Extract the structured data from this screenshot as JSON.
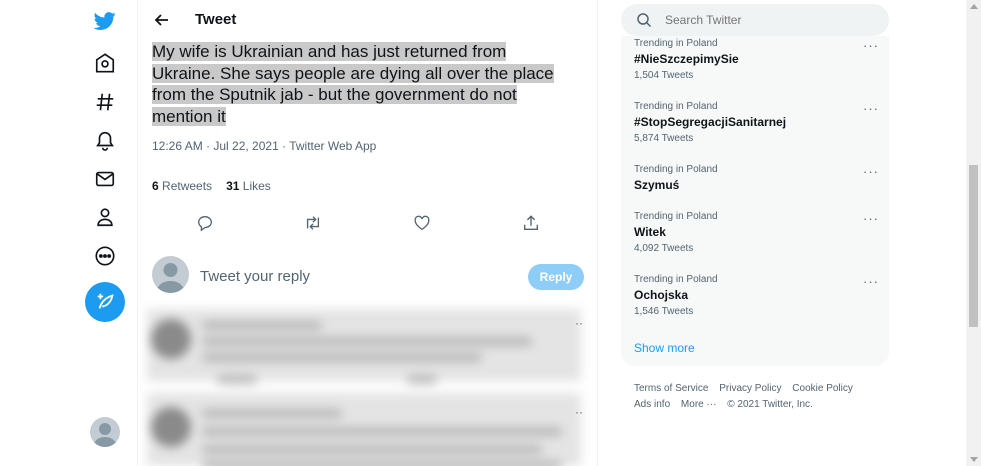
{
  "colors": {
    "accent": "#1d9bf0",
    "highlight": "#c9c9c9",
    "reply_button": "#8ecdf8"
  },
  "nav": {
    "items": [
      {
        "name": "twitter-logo-icon"
      },
      {
        "name": "home-icon"
      },
      {
        "name": "explore-icon"
      },
      {
        "name": "notifications-icon"
      },
      {
        "name": "messages-icon"
      },
      {
        "name": "profile-icon"
      },
      {
        "name": "more-icon"
      }
    ],
    "compose": "compose-tweet-icon"
  },
  "header": {
    "title": "Tweet"
  },
  "tweet": {
    "lines": [
      "My wife is Ukrainian and has just returned from",
      "Ukraine. She says people are dying all over the place",
      "from the Sputnik jab - but the government do not",
      "mention it"
    ],
    "meta": "12:26 AM · Jul 22, 2021 · Twitter Web App",
    "retweets_count": "6",
    "retweets_label": "Retweets",
    "likes_count": "31",
    "likes_label": "Likes"
  },
  "reply": {
    "placeholder": "Tweet your reply",
    "button_label": "Reply"
  },
  "search": {
    "placeholder": "Search Twitter"
  },
  "trends": [
    {
      "context": "Trending in Poland",
      "name": "#NieSzczepimySie",
      "count": "1,504 Tweets"
    },
    {
      "context": "Trending in Poland",
      "name": "#StopSegregacjiSanitarnej",
      "count": "5,874 Tweets"
    },
    {
      "context": "Trending in Poland",
      "name": "Szymuś",
      "count": ""
    },
    {
      "context": "Trending in Poland",
      "name": "Witek",
      "count": "4,092 Tweets"
    },
    {
      "context": "Trending in Poland",
      "name": "Ochojska",
      "count": "1,546 Tweets"
    }
  ],
  "trends_more_label": "···",
  "show_more": "Show more",
  "footer": {
    "terms": "Terms of Service",
    "privacy": "Privacy Policy",
    "cookie": "Cookie Policy",
    "ads": "Ads info",
    "more": "More ···",
    "copyright": "© 2021 Twitter, Inc."
  }
}
